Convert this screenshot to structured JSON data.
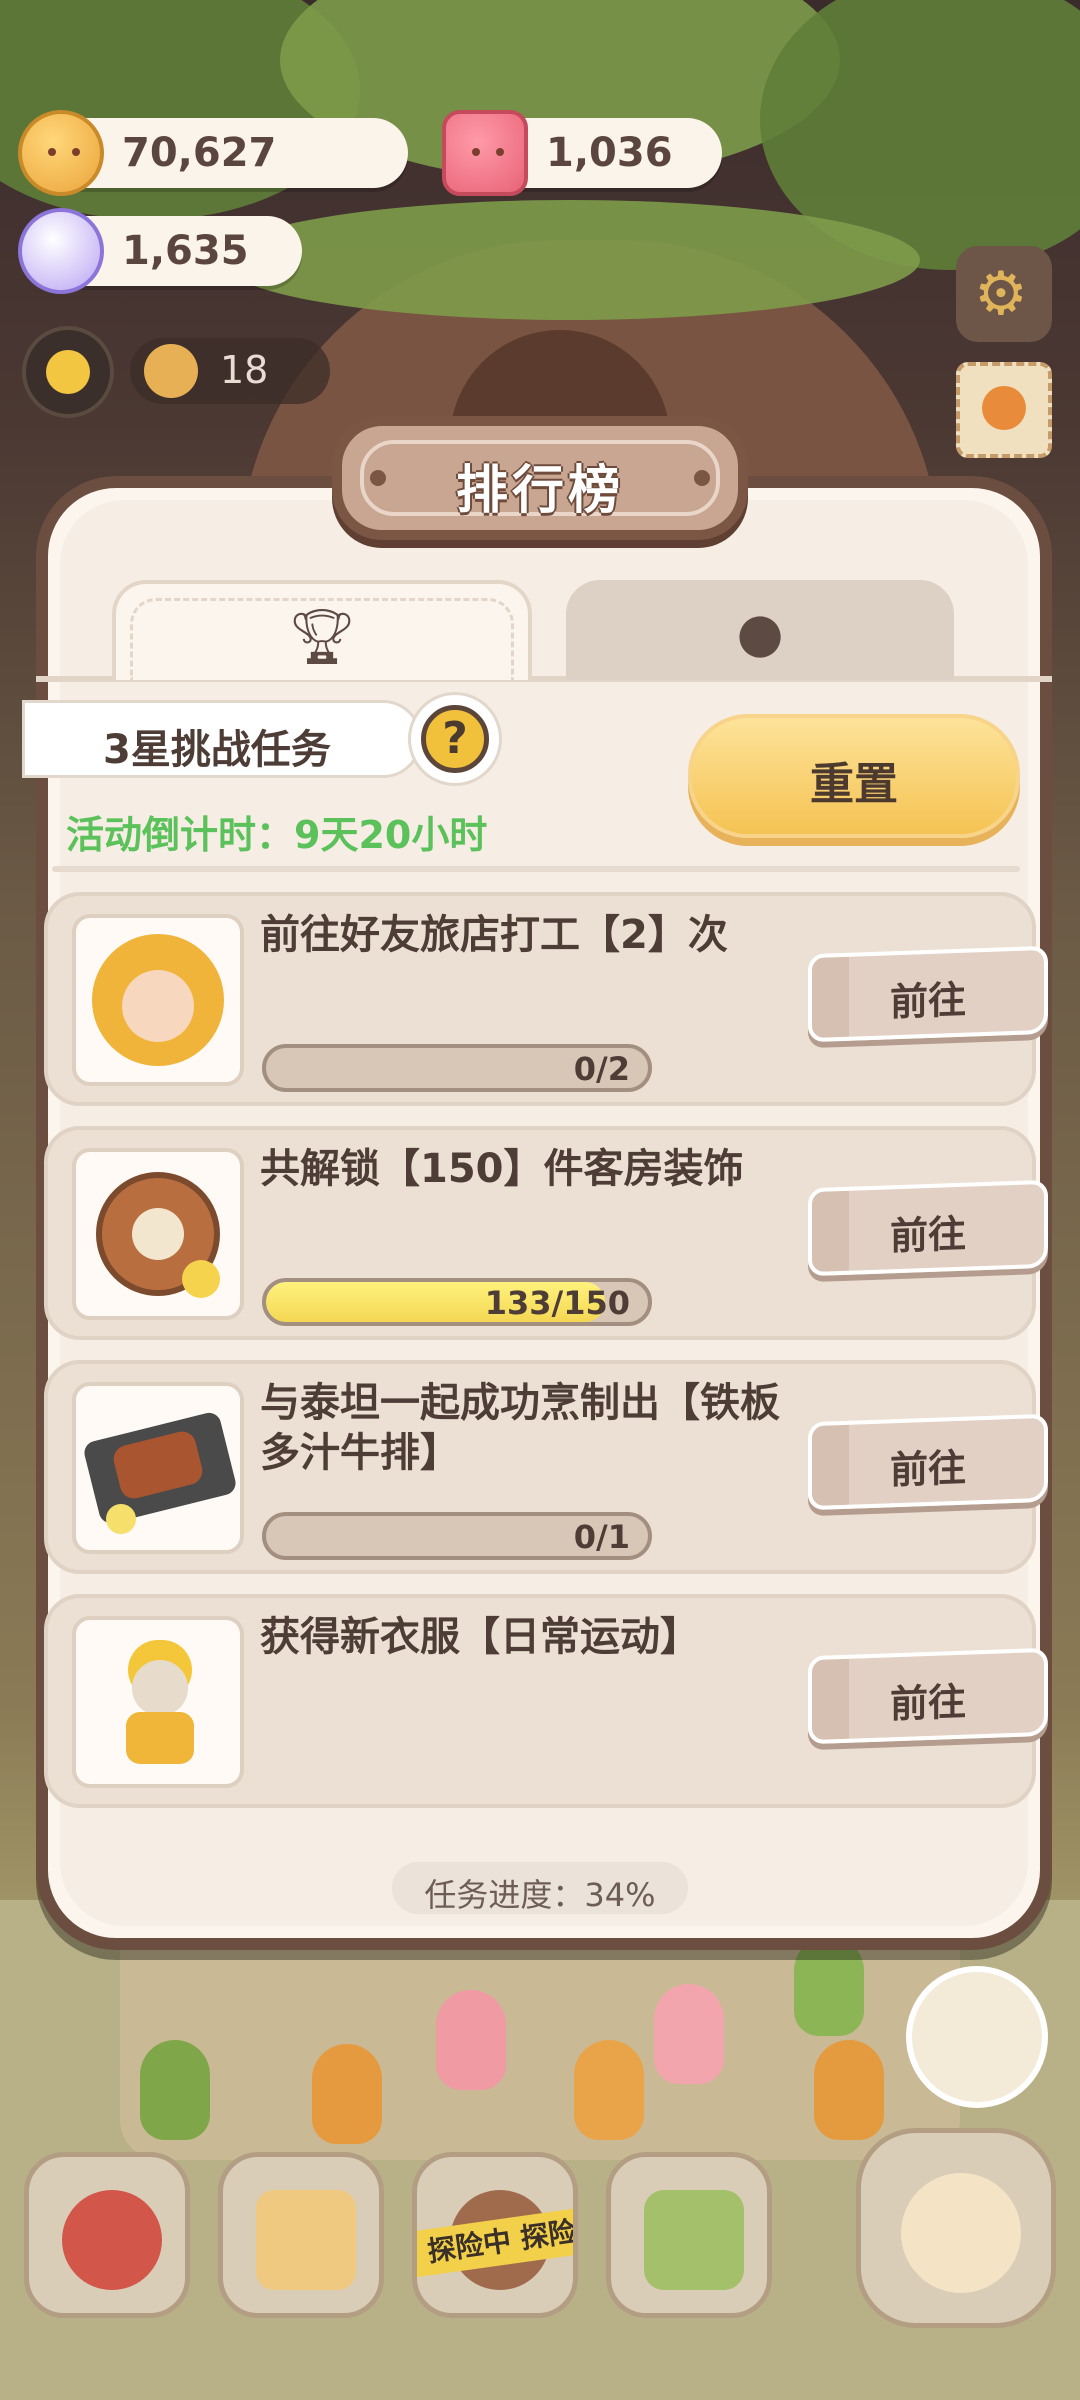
{
  "resources": {
    "coins": "70,627",
    "candles": "1,036",
    "candies": "1,635"
  },
  "hud": {
    "visitor_count": "18"
  },
  "leaderboard": {
    "title": "排行榜",
    "tabs": [
      {
        "icon": "trophy-icon",
        "active": true
      },
      {
        "icon": "cookie-icon",
        "active": false
      }
    ],
    "task_header": "3星挑战任务",
    "countdown": "活动倒计时：9天20小时",
    "reset_label": "重置",
    "tasks": [
      {
        "text": "前往好友旅店打工【2】次",
        "progress_text": "0/2",
        "progress": 0,
        "button": "前往",
        "has_bar": true
      },
      {
        "text": "共解锁【150】件客房装饰",
        "progress_text": "133/150",
        "progress": 0.8867,
        "button": "前往",
        "has_bar": true
      },
      {
        "text": "与泰坦一起成功烹制出【铁板多汁牛排】",
        "progress_text": "0/1",
        "progress": 0,
        "button": "前往",
        "has_bar": true
      },
      {
        "text": "获得新衣服【日常运动】",
        "progress_text": "",
        "progress": 0,
        "button": "前往",
        "has_bar": false
      }
    ],
    "overall_progress": "任务进度：34%"
  },
  "bottom_nav": {
    "expedition_tape": "探险中 探险"
  },
  "colors": {
    "modal_border": "#6b4e3f",
    "reset_button": "#f5c353",
    "countdown_text": "#5bc15a",
    "progress_fill": "#f4d753"
  }
}
